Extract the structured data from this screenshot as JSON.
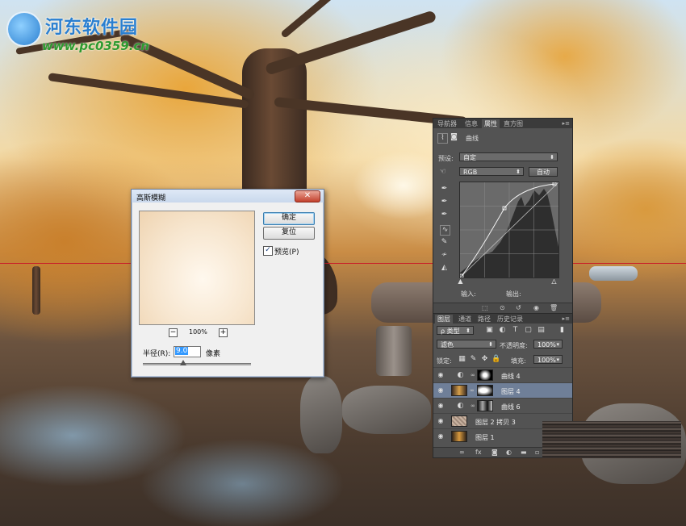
{
  "watermark": {
    "title": "河东软件园",
    "url": "www.pc0359.cn"
  },
  "gaussian_blur": {
    "title": "高斯模糊",
    "ok_label": "确定",
    "reset_label": "复位",
    "preview_checked": true,
    "preview_label": "预览(P)",
    "zoom_minus": "−",
    "zoom_plus": "+",
    "zoom": "100%",
    "radius_label": "半径(R):",
    "radius_value": "9.0",
    "radius_unit": "像素",
    "close": "✕"
  },
  "properties": {
    "tabs": [
      "导航器",
      "信息",
      "属性",
      "直方图"
    ],
    "active_tab": "属性",
    "panel_title": "曲线",
    "preset_label": "预设:",
    "preset_value": "自定",
    "channel_value": "RGB",
    "auto_label": "自动",
    "input_label": "输入:",
    "output_label": "输出:"
  },
  "layers": {
    "tabs": [
      "图层",
      "通道",
      "路径",
      "历史记录"
    ],
    "active_tab": "图层",
    "filter_label": "ρ 类型",
    "blend_mode": "滤色",
    "opacity_label": "不透明度:",
    "opacity_value": "100%",
    "lock_label": "锁定:",
    "fill_label": "填充:",
    "fill_value": "100%",
    "items": [
      {
        "name": "曲线 4",
        "selected": false
      },
      {
        "name": "图层 4",
        "selected": true
      },
      {
        "name": "曲线 6",
        "selected": false
      },
      {
        "name": "图层 2 拷贝 3",
        "selected": false
      },
      {
        "name": "图层 1",
        "selected": false
      }
    ]
  },
  "colors": {
    "panel_bg": "#535353",
    "selected_row": "#6f7f98",
    "guide_line": "#c8232a",
    "dialog_bg": "#f0f0f0"
  }
}
